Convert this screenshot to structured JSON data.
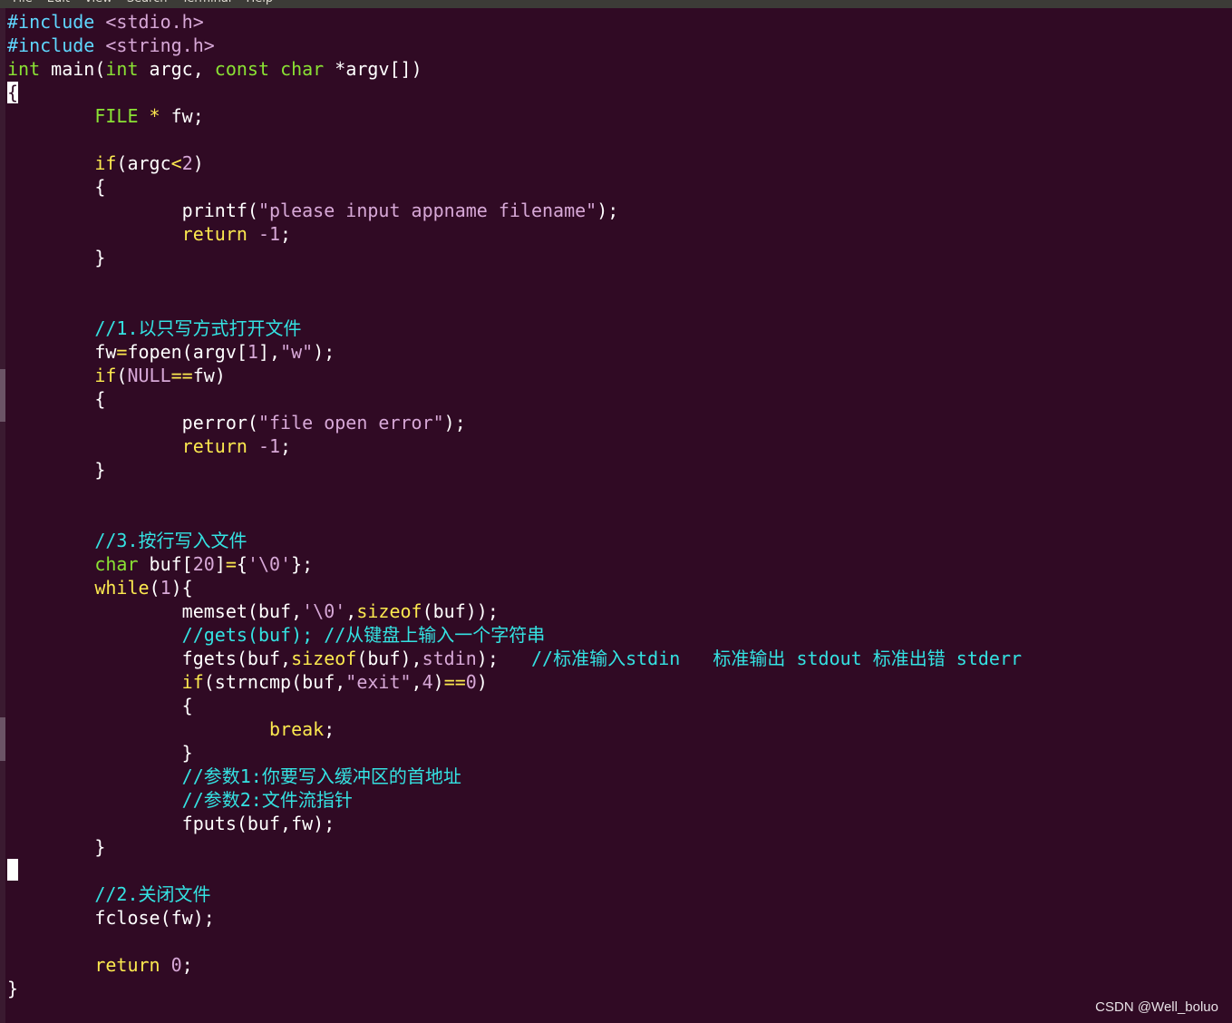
{
  "menu": {
    "items": [
      "File",
      "Edit",
      "View",
      "Search",
      "Terminal",
      "Help"
    ]
  },
  "colors": {
    "background": "#300a24",
    "preprocessor": "#5fd7ff",
    "string": "#d7a8d7",
    "type": "#8ae234",
    "keyword": "#fce94f",
    "comment": "#34e2e2",
    "text": "#ffffff"
  },
  "code": {
    "lines": [
      [
        [
          "pp",
          "#include "
        ],
        [
          "str",
          "<stdio.h>"
        ]
      ],
      [
        [
          "pp",
          "#include "
        ],
        [
          "str",
          "<string.h>"
        ]
      ],
      [
        [
          "typ",
          "int"
        ],
        [
          "",
          " main("
        ],
        [
          "typ",
          "int"
        ],
        [
          "",
          " argc, "
        ],
        [
          "typ",
          "const"
        ],
        [
          "",
          " "
        ],
        [
          "typ",
          "char"
        ],
        [
          "",
          " *argv[])"
        ]
      ],
      [
        [
          "cur",
          "{"
        ]
      ],
      [
        [
          "",
          "        "
        ],
        [
          "typ",
          "FILE"
        ],
        [
          "",
          " "
        ],
        [
          "op",
          "*"
        ],
        [
          "",
          " fw;"
        ]
      ],
      [],
      [
        [
          "",
          "        "
        ],
        [
          "kw",
          "if"
        ],
        [
          "",
          "(argc"
        ],
        [
          "op",
          "<"
        ],
        [
          "num",
          "2"
        ],
        [
          "",
          ")"
        ]
      ],
      [
        [
          "",
          "        {"
        ]
      ],
      [
        [
          "",
          "                printf("
        ],
        [
          "str",
          "\"please input appname filename\""
        ],
        [
          "",
          ");"
        ]
      ],
      [
        [
          "",
          "                "
        ],
        [
          "kw",
          "return"
        ],
        [
          "",
          " "
        ],
        [
          "num",
          "-1"
        ],
        [
          "",
          ";"
        ]
      ],
      [
        [
          "",
          "        }"
        ]
      ],
      [],
      [],
      [
        [
          "",
          "        "
        ],
        [
          "cm",
          "//1.以只写方式打开文件"
        ]
      ],
      [
        [
          "",
          "        fw"
        ],
        [
          "op",
          "="
        ],
        [
          "",
          "fopen(argv["
        ],
        [
          "num",
          "1"
        ],
        [
          "",
          "],"
        ],
        [
          "str",
          "\"w\""
        ],
        [
          "",
          ");"
        ]
      ],
      [
        [
          "",
          "        "
        ],
        [
          "kw",
          "if"
        ],
        [
          "",
          "("
        ],
        [
          "num",
          "NULL"
        ],
        [
          "op",
          "=="
        ],
        [
          "",
          "fw)"
        ]
      ],
      [
        [
          "",
          "        {"
        ]
      ],
      [
        [
          "",
          "                perror("
        ],
        [
          "str",
          "\"file open error\""
        ],
        [
          "",
          ");"
        ]
      ],
      [
        [
          "",
          "                "
        ],
        [
          "kw",
          "return"
        ],
        [
          "",
          " "
        ],
        [
          "num",
          "-1"
        ],
        [
          "",
          ";"
        ]
      ],
      [
        [
          "",
          "        }"
        ]
      ],
      [],
      [],
      [
        [
          "",
          "        "
        ],
        [
          "cm",
          "//3.按行写入文件"
        ]
      ],
      [
        [
          "",
          "        "
        ],
        [
          "typ",
          "char"
        ],
        [
          "",
          " buf["
        ],
        [
          "num",
          "20"
        ],
        [
          "",
          "]"
        ],
        [
          "op",
          "="
        ],
        [
          "",
          "{"
        ],
        [
          "str",
          "'\\0'"
        ],
        [
          "",
          "};"
        ]
      ],
      [
        [
          "",
          "        "
        ],
        [
          "kw",
          "while"
        ],
        [
          "",
          "("
        ],
        [
          "num",
          "1"
        ],
        [
          "",
          "){"
        ]
      ],
      [
        [
          "",
          "                memset(buf,"
        ],
        [
          "str",
          "'\\0'"
        ],
        [
          "",
          ","
        ],
        [
          "kw",
          "sizeof"
        ],
        [
          "",
          "(buf));"
        ]
      ],
      [
        [
          "",
          "                "
        ],
        [
          "cm",
          "//gets(buf); //从键盘上输入一个字符串"
        ]
      ],
      [
        [
          "",
          "                fgets(buf,"
        ],
        [
          "kw",
          "sizeof"
        ],
        [
          "",
          "(buf),"
        ],
        [
          "str",
          "stdin"
        ],
        [
          "",
          ");   "
        ],
        [
          "cm",
          "//标准输入stdin   标准输出 stdout 标准出错 stderr"
        ]
      ],
      [
        [
          "",
          "                "
        ],
        [
          "kw",
          "if"
        ],
        [
          "",
          "(strncmp(buf,"
        ],
        [
          "str",
          "\"exit\""
        ],
        [
          "",
          ","
        ],
        [
          "num",
          "4"
        ],
        [
          "",
          ")"
        ],
        [
          "op",
          "=="
        ],
        [
          "num",
          "0"
        ],
        [
          "",
          ")"
        ]
      ],
      [
        [
          "",
          "                {"
        ]
      ],
      [
        [
          "",
          "                        "
        ],
        [
          "kw",
          "break"
        ],
        [
          "",
          ";"
        ]
      ],
      [
        [
          "",
          "                }"
        ]
      ],
      [
        [
          "",
          "                "
        ],
        [
          "cm",
          "//参数1:你要写入缓冲区的首地址"
        ]
      ],
      [
        [
          "",
          "                "
        ],
        [
          "cm",
          "//参数2:文件流指针"
        ]
      ],
      [
        [
          "",
          "                fputs(buf,fw);"
        ]
      ],
      [
        [
          "",
          "        }"
        ]
      ],
      [
        [
          "blk",
          ""
        ]
      ],
      [
        [
          "",
          "        "
        ],
        [
          "cm",
          "//2.关闭文件"
        ]
      ],
      [
        [
          "",
          "        fclose(fw);"
        ]
      ],
      [],
      [
        [
          "",
          "        "
        ],
        [
          "kw",
          "return"
        ],
        [
          "",
          " "
        ],
        [
          "num",
          "0"
        ],
        [
          "",
          ";"
        ]
      ],
      [
        [
          "",
          "}"
        ]
      ]
    ]
  },
  "watermark": "CSDN @Well_boluo"
}
